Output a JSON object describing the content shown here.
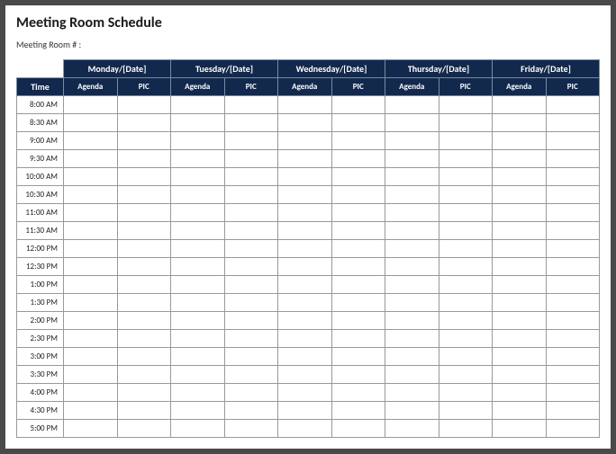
{
  "title": "Meeting Room Schedule",
  "sublabel": "Meeting Room # :",
  "timeHeader": "Time",
  "days": [
    "Monday/[Date]",
    "Tuesday/[Date]",
    "Wednesday/[Date]",
    "Thursday/[Date]",
    "Friday/[Date]"
  ],
  "subHeaders": {
    "agenda": "Agenda",
    "pic": "PIC"
  },
  "times": [
    "8:00 AM",
    "8:30 AM",
    "9:00 AM",
    "9:30 AM",
    "10:00 AM",
    "10:30 AM",
    "11:00 AM",
    "11:30 AM",
    "12:00 PM",
    "12:30 PM",
    "1:00 PM",
    "1:30 PM",
    "2:00 PM",
    "2:30 PM",
    "3:00 PM",
    "3:30 PM",
    "4:00 PM",
    "4:30 PM",
    "5:00 PM"
  ]
}
